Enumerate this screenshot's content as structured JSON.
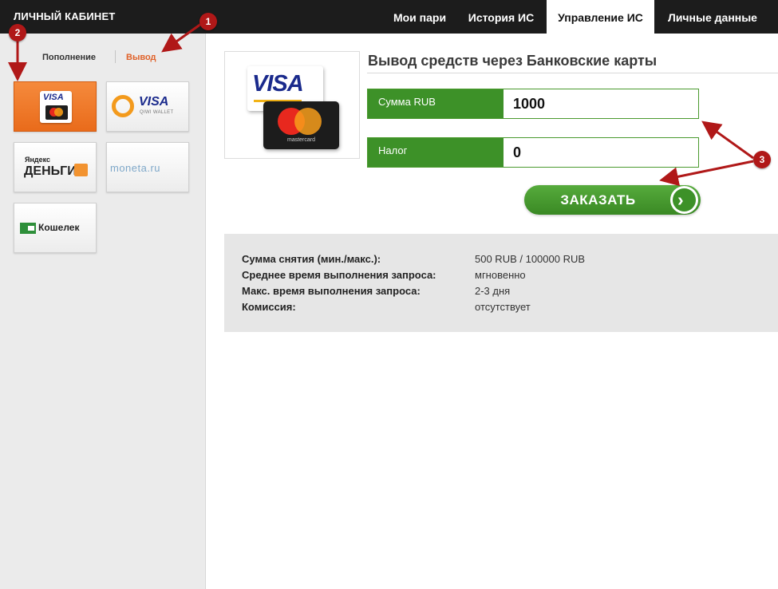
{
  "header": {
    "brand": "ЛИЧНЫЙ КАБИНЕТ",
    "tabs": [
      {
        "label": "Мои пари"
      },
      {
        "label": "История ИС"
      },
      {
        "label": "Управление ИС"
      },
      {
        "label": "Личные данные"
      }
    ],
    "active_tab": "Управление ИС"
  },
  "sidebar": {
    "subtabs": [
      {
        "label": "Пополнение"
      },
      {
        "label": "Вывод"
      }
    ],
    "active_subtab": "Вывод",
    "methods": [
      {
        "name": "visa-mastercard",
        "visa": "VISA"
      },
      {
        "name": "qiwi-visa-wallet",
        "visa": "VISA",
        "sub": "QIWI WALLET"
      },
      {
        "name": "yandex-money",
        "top": "Яндекс",
        "main": "ДЕНЬГИ"
      },
      {
        "name": "moneta-ru",
        "text": "moneta.ru"
      },
      {
        "name": "koshelek",
        "text": "Кошелек"
      }
    ]
  },
  "main": {
    "logo": {
      "visa": "VISA",
      "mastercard": "mastercard"
    },
    "title": "Вывод средств через Банковские карты",
    "fields": [
      {
        "label": "Сумма RUB",
        "value": "1000"
      },
      {
        "label": "Налог",
        "value": "0"
      }
    ],
    "order_button": "ЗАКАЗАТЬ"
  },
  "info": {
    "rows": [
      {
        "label": "Сумма снятия (мин./макс.):",
        "value": "500 RUB / 100000 RUB"
      },
      {
        "label": "Среднее время выполнения запроса:",
        "value": "мгновенно"
      },
      {
        "label": "Макс. время выполнения запроса:",
        "value": "2-3 дня"
      },
      {
        "label": "Комиссия:",
        "value": "отсутствует"
      }
    ]
  },
  "annotations": {
    "markers": [
      "1",
      "2",
      "3"
    ],
    "color": "#b01818"
  },
  "colors": {
    "accent_green": "#3d9128",
    "accent_orange": "#e0622a",
    "header_bg": "#1c1c1c"
  }
}
